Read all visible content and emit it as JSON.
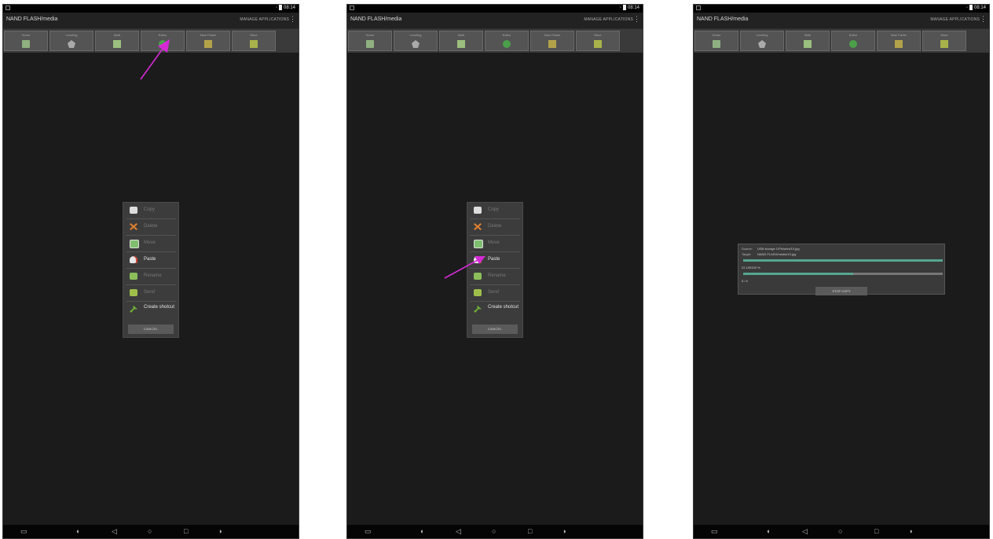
{
  "colors": {
    "background": "#1b1b1b",
    "toolbar": "#3a3a3a",
    "menu": "#3c3c3c",
    "arrow": "#d42ad4",
    "progress": "#57a68f"
  },
  "panel1": {
    "app_title": "NAND FLASH/media",
    "manage_label": "MANAGE APPLICATIONS",
    "status_time": "08:14",
    "tools": [
      {
        "label": "Home",
        "icon": "home-icon"
      },
      {
        "label": "Leveling",
        "icon": "level-icon"
      },
      {
        "label": "Multi",
        "icon": "multi-icon"
      },
      {
        "label": "Editor",
        "icon": "editor-icon"
      },
      {
        "label": "New Folder",
        "icon": "new-folder-icon"
      },
      {
        "label": "More",
        "icon": "more-icon"
      }
    ],
    "menu": {
      "items": [
        "Copy",
        "Delete",
        "Move",
        "Paste",
        "Rename",
        "Send",
        "Create shotcut"
      ],
      "cancel": "CANCEL"
    }
  },
  "panel2": {
    "app_title": "NAND FLASH/media",
    "manage_label": "MANAGE APPLICATIONS",
    "status_time": "08:14",
    "tools": [
      {
        "label": "Home"
      },
      {
        "label": "Leveling"
      },
      {
        "label": "Multi"
      },
      {
        "label": "Editor"
      },
      {
        "label": "New Folder"
      },
      {
        "label": "More"
      }
    ],
    "menu": {
      "items": [
        "Copy",
        "Delete",
        "Move",
        "Paste",
        "Rename",
        "Send",
        "Create shotcut"
      ],
      "cancel": "CANCEL"
    }
  },
  "panel3": {
    "app_title": "NAND FLASH/media",
    "manage_label": "MANAGE APPLICATIONS",
    "status_time": "08:14",
    "tools": [
      {
        "label": "Home"
      },
      {
        "label": "Leveling"
      },
      {
        "label": "Multi"
      },
      {
        "label": "Editor"
      },
      {
        "label": "New Folder"
      },
      {
        "label": "More"
      }
    ],
    "copy_dialog": {
      "source_label": "Source:",
      "source": "USB storage 1/Pictures/10.jpg",
      "target_label": "Target:",
      "target": "NAND FLASH/media/10.jpg",
      "percent_text": "22.199333 %",
      "count_text": "5 / 6",
      "stop_label": "STOP COPY",
      "file_progress": 1.0,
      "total_progress": 0.55
    }
  }
}
